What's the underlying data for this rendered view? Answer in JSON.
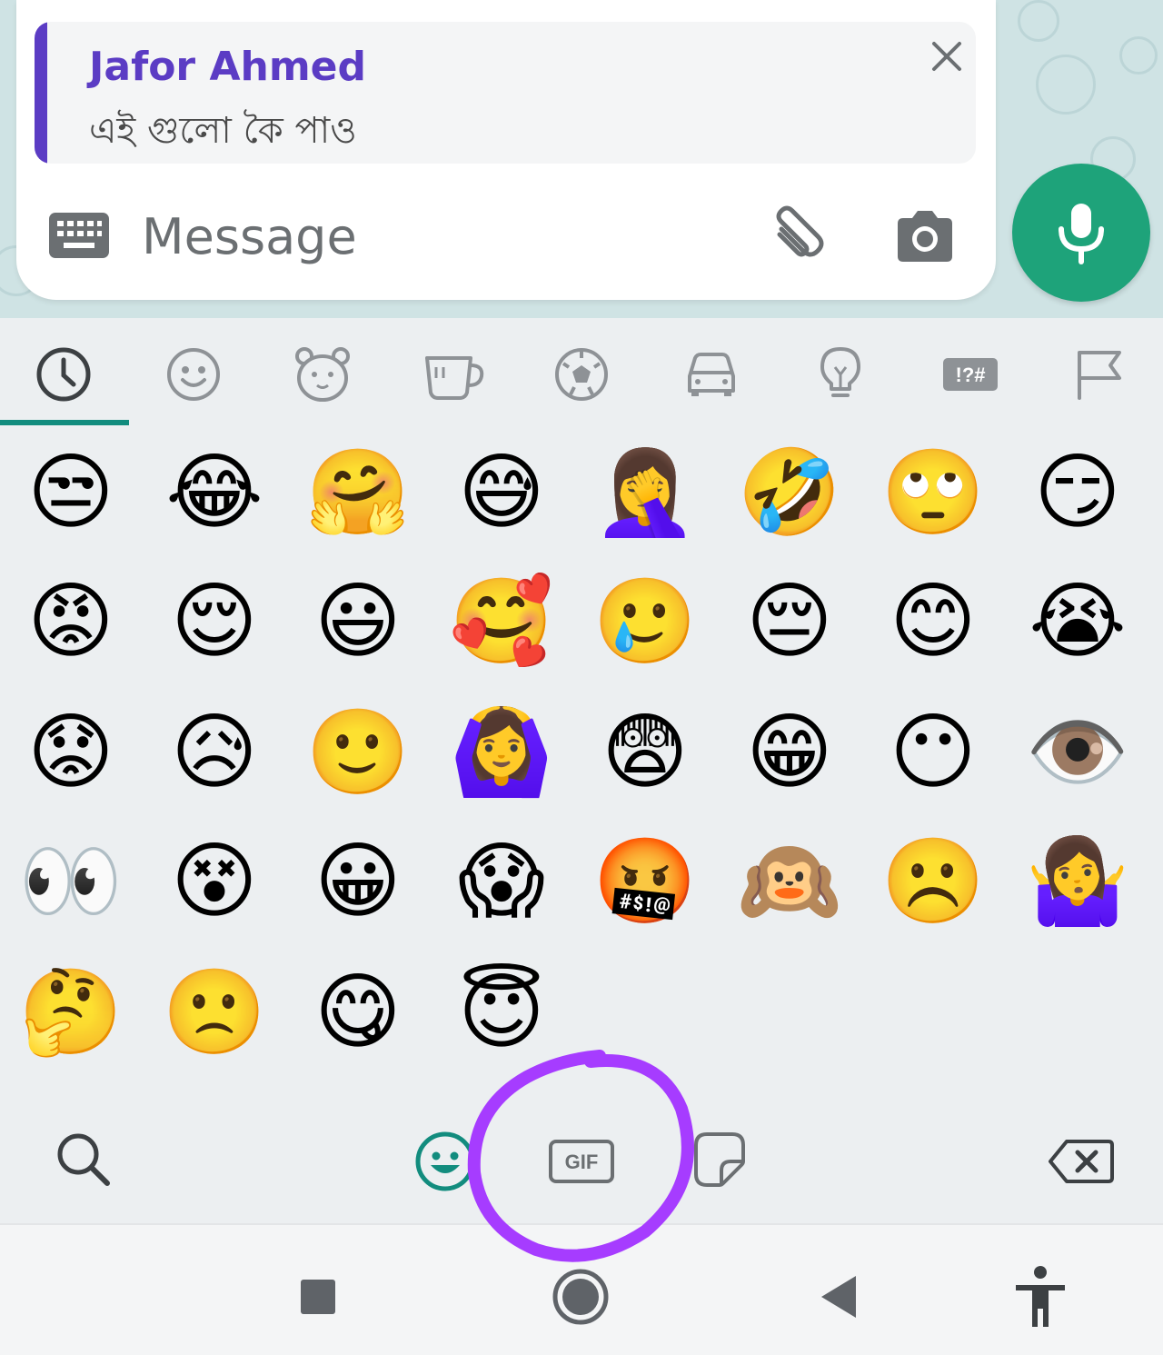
{
  "reply": {
    "name": "Jafor Ahmed",
    "text": "এই গুলো কৈ পাও"
  },
  "composer": {
    "placeholder": "Message"
  },
  "categories": [
    "recent",
    "smileys",
    "animals",
    "food",
    "activity",
    "travel",
    "objects",
    "symbols",
    "flags"
  ],
  "symbols_label": "!?#",
  "emoji_rows": [
    [
      "😒",
      "😂",
      "🤗",
      "😅",
      "🤦‍♀️",
      "🤣",
      "🙄",
      "😏"
    ],
    [
      "😡",
      "😌",
      "😃",
      "🥰",
      "🥲",
      "😔",
      "😊",
      "😭"
    ],
    [
      "😟",
      "😥",
      "🙂",
      "🙆‍♀️",
      "😨",
      "😁",
      "😶",
      "👁️"
    ],
    [
      "👀",
      "😵",
      "😀",
      "😱",
      "🤬",
      "🙉",
      "☹️",
      "🤷‍♀️"
    ],
    [
      "🤔",
      "🙁",
      "😋",
      "😇"
    ]
  ],
  "bottom": {
    "gif_label": "GIF"
  },
  "colors": {
    "accent": "#128c7e",
    "mic": "#1ea37a",
    "reply_bar": "#5b3cc4",
    "annotation": "#a63cff"
  }
}
